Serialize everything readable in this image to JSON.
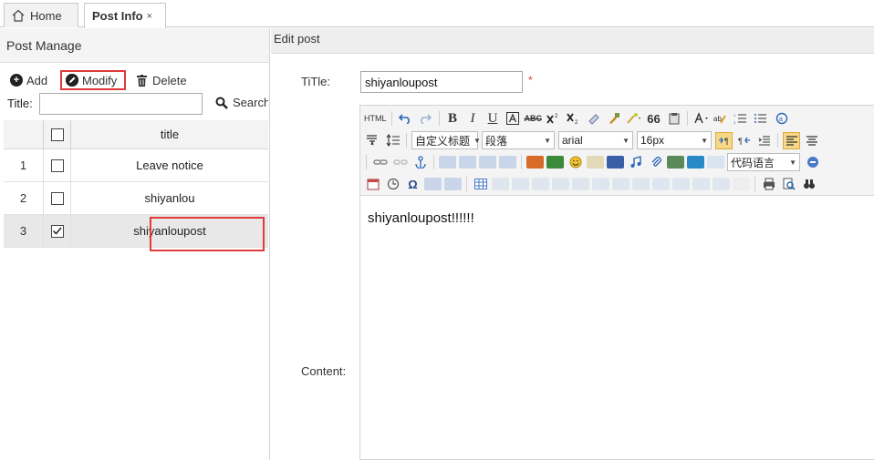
{
  "tabs": [
    {
      "label": "Home"
    },
    {
      "label": "Post Info",
      "close": "×"
    }
  ],
  "left": {
    "panel_title": "Post Manage",
    "toolbar": {
      "add": "Add",
      "modify": "Modify",
      "delete": "Delete"
    },
    "search": {
      "label": "Title:",
      "value": "",
      "button": "Search"
    },
    "table": {
      "header": "title",
      "rows": [
        {
          "num": "1",
          "title": "Leave notice",
          "checked": false
        },
        {
          "num": "2",
          "title": "shiyanlou",
          "checked": false
        },
        {
          "num": "3",
          "title": "shiyanloupost",
          "checked": true
        }
      ]
    }
  },
  "editor": {
    "panel_title": "Edit post",
    "title_label": "TiTle:",
    "title_value": "shiyanloupost",
    "required_mark": "*",
    "content_label": "Content:",
    "content_text": "shiyanloupost!!!!!!",
    "toolbar": {
      "html_label": "HTML",
      "bold": "B",
      "italic": "I",
      "underline": "U",
      "strike": "ABC",
      "custom_heading": "自定义标题",
      "paragraph": "段落",
      "font_family": "arial",
      "font_size": "16px",
      "code_language": "代码语言"
    }
  },
  "colors": {
    "highlight": "#e03a3a",
    "active_button": "#f7d88a"
  }
}
